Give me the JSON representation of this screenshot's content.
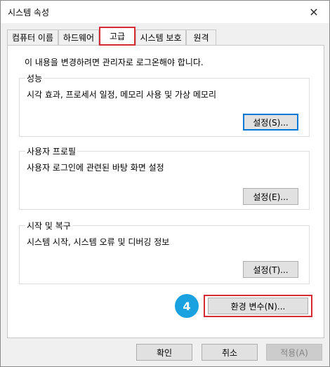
{
  "window": {
    "title": "시스템 속성",
    "close_glyph": "✕"
  },
  "tabs": [
    {
      "label": "컴퓨터 이름"
    },
    {
      "label": "하드웨어"
    },
    {
      "label": "고급"
    },
    {
      "label": "시스템 보호"
    },
    {
      "label": "원격"
    }
  ],
  "advanced": {
    "admin_note": "이 내용을 변경하려면 관리자로 로그온해야 합니다.",
    "performance": {
      "title": "성능",
      "description": "시각 효과, 프로세서 일정, 메모리 사용 및 가상 메모리",
      "settings_label": "설정(S)..."
    },
    "user_profiles": {
      "title": "사용자 프로필",
      "description": "사용자 로그인에 관련된 바탕 화면 설정",
      "settings_label": "설정(E)..."
    },
    "startup_recovery": {
      "title": "시작 및 복구",
      "description": "시스템 시작, 시스템 오류 및 디버깅 정보",
      "settings_label": "설정(T)..."
    },
    "env_vars_label": "환경 변수(N)...",
    "step_number": "4"
  },
  "footer": {
    "ok_label": "확인",
    "cancel_label": "취소",
    "apply_label": "적용(A)"
  },
  "colors": {
    "highlight": "#d62b35",
    "step_badge": "#1aa1e0",
    "focus": "#0078d7"
  }
}
